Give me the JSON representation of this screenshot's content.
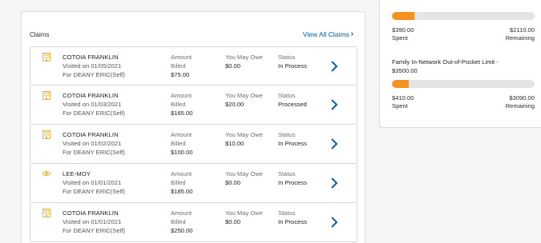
{
  "claims": {
    "title": "Claims",
    "view_all": "View All Claims",
    "rows": [
      {
        "provider": "COTOIA FRANKLIN",
        "visited": "Visited on 01/05/2021",
        "for": "For DEANY ERIC(Self)",
        "amount_label_1": "Amount",
        "amount_label_2": "Billed",
        "amount": "$75.00",
        "owe_label": "You May Owe",
        "owe": "$0.00",
        "status_label": "Status",
        "status": "In Process",
        "icon": "building-icon"
      },
      {
        "provider": "COTOIA FRANKLIN",
        "visited": "Visited on 01/03/2021",
        "for": "For DEANY ERIC(Self)",
        "amount_label_1": "Amount",
        "amount_label_2": "Billed",
        "amount": "$165.00",
        "owe_label": "You May Owe",
        "owe": "$20.00",
        "status_label": "Status",
        "status": "Processed",
        "icon": "building-icon"
      },
      {
        "provider": "COTOIA FRANKLIN",
        "visited": "Visited on 01/02/2021",
        "for": "For DEANY ERIC(Self)",
        "amount_label_1": "Amount",
        "amount_label_2": "Billed",
        "amount": "$100.00",
        "owe_label": "You May Owe",
        "owe": "$10.00",
        "status_label": "Status",
        "status": "In Process",
        "icon": "building-icon"
      },
      {
        "provider": "LEE-MOY",
        "visited": "Visited on 01/01/2021",
        "for": "For DEANY ERIC(Self)",
        "amount_label_1": "Amount",
        "amount_label_2": "Billed",
        "amount": "$185.00",
        "owe_label": "You May Owe",
        "owe": "$0.00",
        "status_label": "Status",
        "status": "In Process",
        "icon": "eye-icon"
      },
      {
        "provider": "COTOIA FRANKLIN",
        "visited": "Visited on 01/01/2021",
        "for": "For DEANY ERIC(Self)",
        "amount_label_1": "Amount",
        "amount_label_2": "Billed",
        "amount": "$250.00",
        "owe_label": "You May Owe",
        "owe": "$0.00",
        "status_label": "Status",
        "status": "In Process",
        "icon": "building-icon"
      }
    ]
  },
  "limits": {
    "first": {
      "progress": 0.156,
      "spent_amount": "$390.00",
      "spent_label": "Spent",
      "remaining_amount": "$2110.00",
      "remaining_label": "Remaining"
    },
    "second": {
      "title": "Family In-Network Out-of-Pocket Limit - $3500.00",
      "progress": 0.117,
      "spent_amount": "$410.00",
      "spent_label": "Spent",
      "remaining_amount": "$3090.00",
      "remaining_label": "Remaining"
    }
  },
  "colors": {
    "accent": "#f5911e",
    "link": "#0b5fa5",
    "chevron": "#0b5fa5",
    "icon": "#e6b84c"
  }
}
